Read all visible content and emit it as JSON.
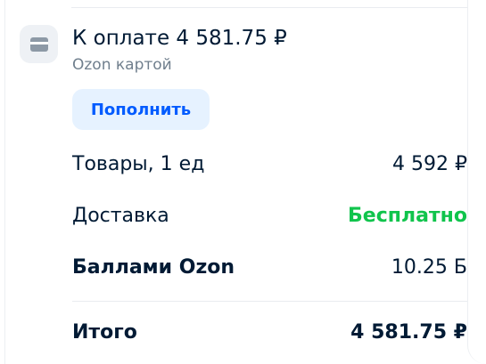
{
  "payment": {
    "title": "К оплате 4 581.75 ₽",
    "method": "Ozon картой",
    "topup_label": "Пополнить",
    "icon": "card-icon"
  },
  "summary": {
    "rows": [
      {
        "label": "Товары, 1 ед",
        "value": "4 592 ₽"
      },
      {
        "label": "Доставка",
        "value": "Бесплатно"
      },
      {
        "label": "Баллами Ozon",
        "value": "10.25 Б"
      }
    ],
    "total_label": "Итого",
    "total_value": "4 581.75 ₽"
  },
  "colors": {
    "accent": "#005bff",
    "accent_bg": "#e6f2ff",
    "free": "#10c44c",
    "text": "#001a34",
    "muted": "#707f8d"
  }
}
